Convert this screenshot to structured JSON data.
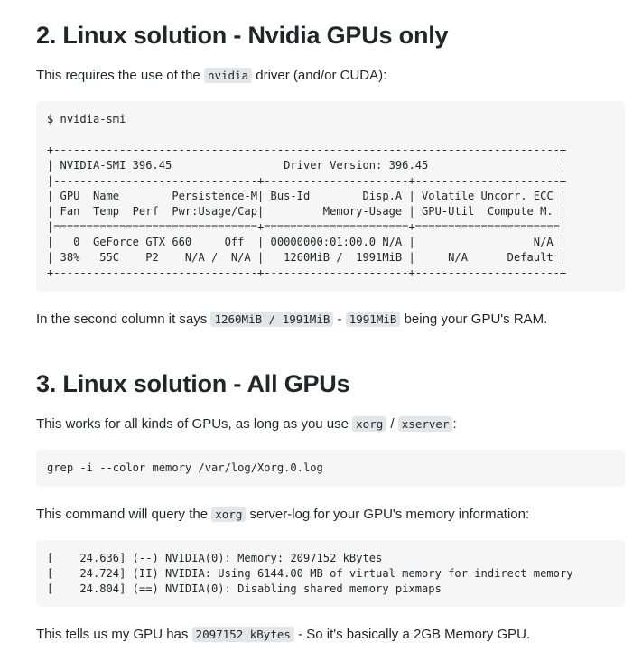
{
  "section2": {
    "heading": "2. Linux solution - Nvidia GPUs only",
    "intro_before": "This requires the use of the ",
    "intro_code": "nvidia",
    "intro_after": " driver (and/or CUDA):",
    "code_block": "$ nvidia-smi\n\n+-----------------------------------------------------------------------------+\n| NVIDIA-SMI 396.45                 Driver Version: 396.45                    |\n|-------------------------------+----------------------+----------------------+\n| GPU  Name        Persistence-M| Bus-Id        Disp.A | Volatile Uncorr. ECC |\n| Fan  Temp  Perf  Pwr:Usage/Cap|         Memory-Usage | GPU-Util  Compute M. |\n|===============================+======================+======================|\n|   0  GeForce GTX 660     Off  | 00000000:01:00.0 N/A |                  N/A |\n| 38%   55C    P2    N/A /  N/A |   1260MiB /  1991MiB |     N/A      Default |\n+-------------------------------+----------------------+----------------------+",
    "note_before": "In the second column it says ",
    "note_code1": "1260MiB / 1991MiB",
    "note_mid": " - ",
    "note_code2": "1991MiB",
    "note_after": " being your GPU's RAM."
  },
  "section3": {
    "heading": "3. Linux solution - All GPUs",
    "intro_before": "This works for all kinds of GPUs, as long as you use ",
    "intro_code1": "xorg",
    "intro_sep": " / ",
    "intro_code2": "xserver",
    "intro_after": ":",
    "grep_command": "grep -i --color memory /var/log/Xorg.0.log",
    "query_before": "This command will query the ",
    "query_code": "xorg",
    "query_after": " server-log for your GPU's memory information:",
    "log_output": "[    24.636] (--) NVIDIA(0): Memory: 2097152 kBytes\n[    24.724] (II) NVIDIA: Using 6144.00 MB of virtual memory for indirect memory\n[    24.804] (==) NVIDIA(0): Disabling shared memory pixmaps",
    "conclusion_before": "This tells us my GPU has ",
    "conclusion_code": "2097152 kBytes",
    "conclusion_after": " - So it's basically a 2GB Memory GPU."
  }
}
